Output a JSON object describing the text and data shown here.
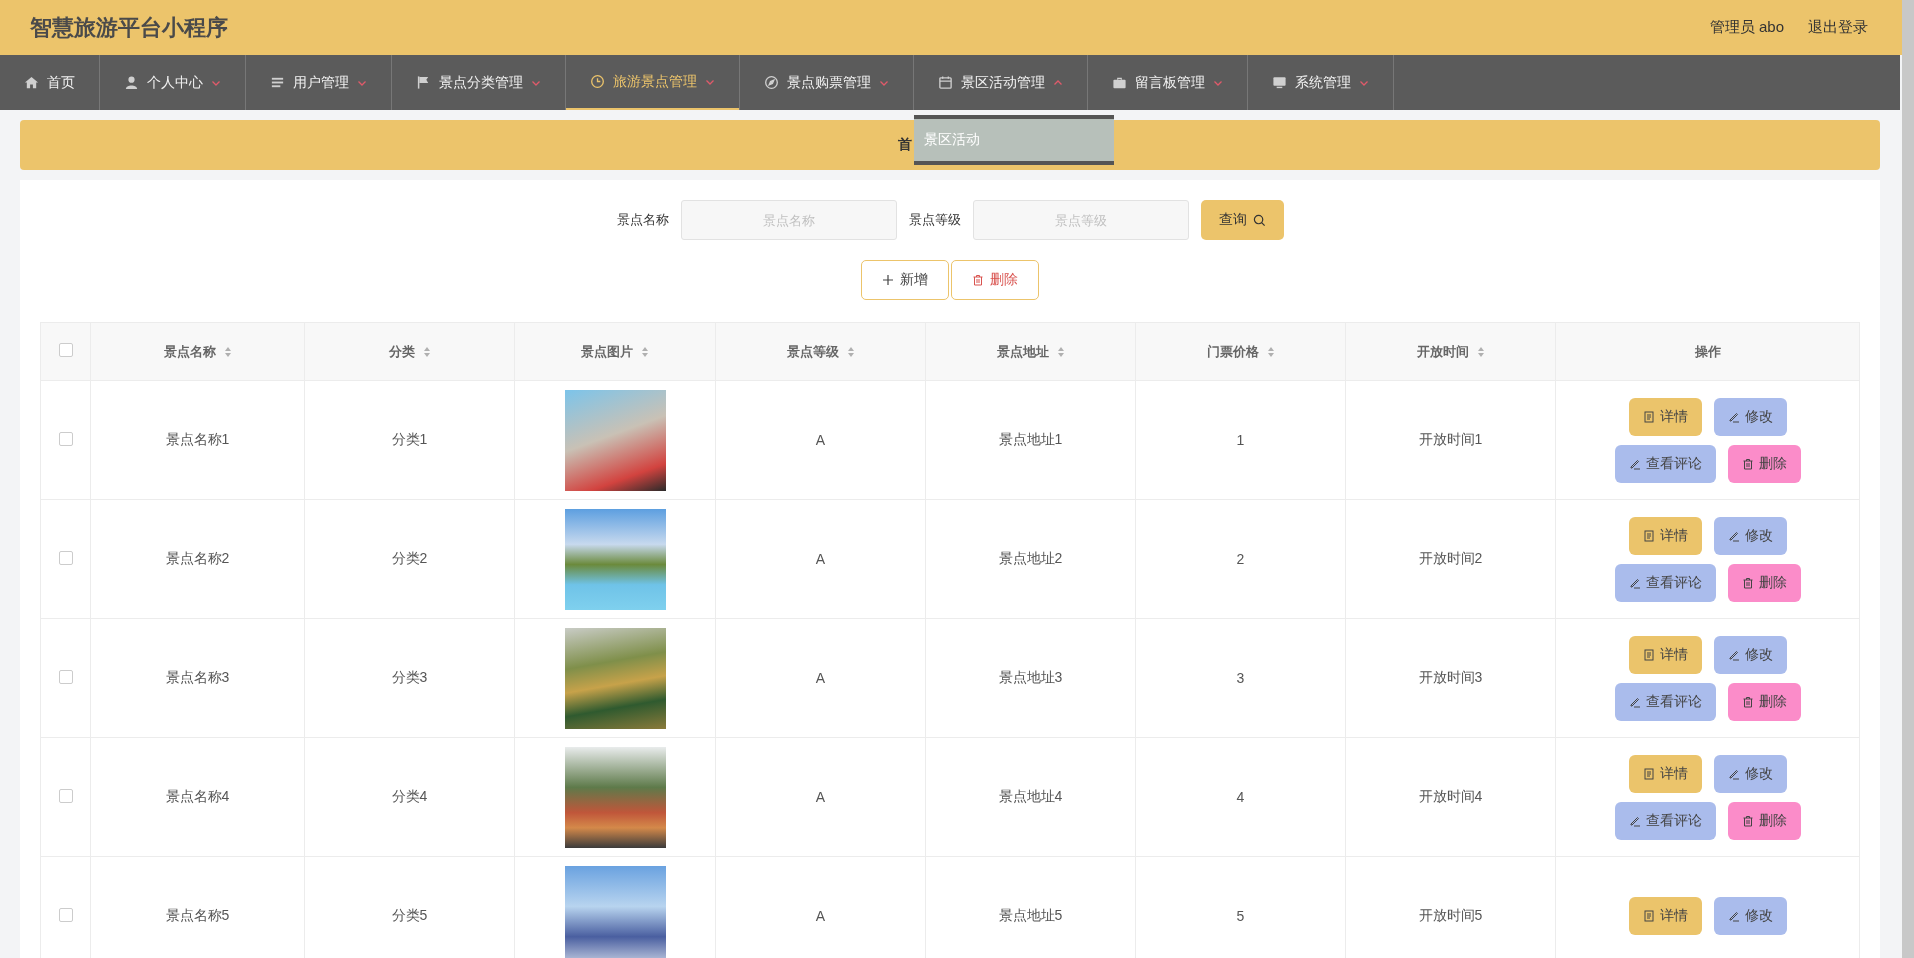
{
  "header": {
    "title": "智慧旅游平台小程序",
    "user": "管理员 abo",
    "logout": "退出登录"
  },
  "nav": [
    {
      "kind": "link",
      "label": "首页",
      "selected": false
    },
    {
      "kind": "menu",
      "label": "个人中心",
      "selected": false,
      "expanded": false
    },
    {
      "kind": "menu",
      "label": "用户管理",
      "selected": false,
      "expanded": false
    },
    {
      "kind": "menu",
      "label": "景点分类管理",
      "selected": false,
      "expanded": false
    },
    {
      "kind": "menu",
      "label": "旅游景点管理",
      "selected": true,
      "expanded": false
    },
    {
      "kind": "menu",
      "label": "景点购票管理",
      "selected": false,
      "expanded": false
    },
    {
      "kind": "menu",
      "label": "景区活动管理",
      "selected": false,
      "expanded": true,
      "children": [
        {
          "label": "景区活动"
        }
      ]
    },
    {
      "kind": "menu",
      "label": "留言板管理",
      "selected": false,
      "expanded": false
    },
    {
      "kind": "menu",
      "label": "系统管理",
      "selected": false,
      "expanded": false
    }
  ],
  "breadcrumb": "首",
  "search": {
    "fields": [
      {
        "label": "景点名称",
        "placeholder": "景点名称"
      },
      {
        "label": "景点等级",
        "placeholder": "景点等级"
      }
    ],
    "button": "查询"
  },
  "toolbar": [
    {
      "kind": "add",
      "label": "新增"
    },
    {
      "kind": "delete",
      "label": "删除"
    }
  ],
  "table": {
    "all_checked": false,
    "columns": [
      {
        "label": "景点名称",
        "sortable": true
      },
      {
        "label": "分类",
        "sortable": true
      },
      {
        "label": "景点图片",
        "sortable": true
      },
      {
        "label": "景点等级",
        "sortable": true
      },
      {
        "label": "景点地址",
        "sortable": true
      },
      {
        "label": "门票价格",
        "sortable": true
      },
      {
        "label": "开放时间",
        "sortable": true
      },
      {
        "label": "操作",
        "sortable": false
      }
    ],
    "rows": [
      {
        "checked": false,
        "cells": [
          "景点名称1",
          "分类1",
          "",
          "A",
          "景点地址1",
          "1",
          "开放时间1"
        ],
        "actions": [
          {
            "kind": "detail",
            "label": "详情"
          },
          {
            "kind": "edit",
            "label": "修改"
          },
          {
            "kind": "comment",
            "label": "查看评论"
          },
          {
            "kind": "delete",
            "label": "删除"
          }
        ]
      },
      {
        "checked": false,
        "cells": [
          "景点名称2",
          "分类2",
          "",
          "A",
          "景点地址2",
          "2",
          "开放时间2"
        ],
        "actions": [
          {
            "kind": "detail",
            "label": "详情"
          },
          {
            "kind": "edit",
            "label": "修改"
          },
          {
            "kind": "comment",
            "label": "查看评论"
          },
          {
            "kind": "delete",
            "label": "删除"
          }
        ]
      },
      {
        "checked": false,
        "cells": [
          "景点名称3",
          "分类3",
          "",
          "A",
          "景点地址3",
          "3",
          "开放时间3"
        ],
        "actions": [
          {
            "kind": "detail",
            "label": "详情"
          },
          {
            "kind": "edit",
            "label": "修改"
          },
          {
            "kind": "comment",
            "label": "查看评论"
          },
          {
            "kind": "delete",
            "label": "删除"
          }
        ]
      },
      {
        "checked": false,
        "cells": [
          "景点名称4",
          "分类4",
          "",
          "A",
          "景点地址4",
          "4",
          "开放时间4"
        ],
        "actions": [
          {
            "kind": "detail",
            "label": "详情"
          },
          {
            "kind": "edit",
            "label": "修改"
          },
          {
            "kind": "comment",
            "label": "查看评论"
          },
          {
            "kind": "delete",
            "label": "删除"
          }
        ]
      },
      {
        "checked": false,
        "cells": [
          "景点名称5",
          "分类5",
          "",
          "A",
          "景点地址5",
          "5",
          "开放时间5"
        ],
        "actions": [
          {
            "kind": "detail",
            "label": "详情"
          },
          {
            "kind": "edit",
            "label": "修改"
          }
        ]
      }
    ]
  }
}
